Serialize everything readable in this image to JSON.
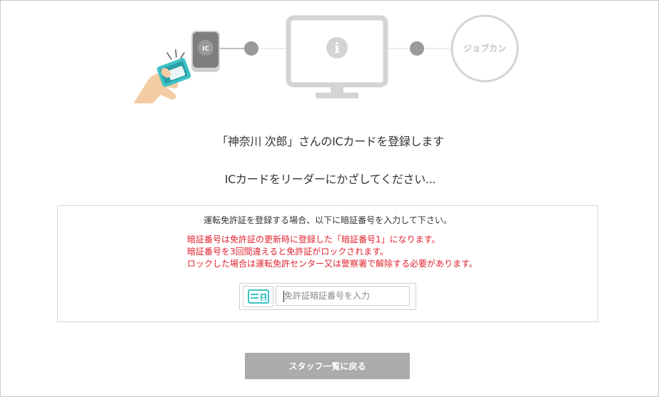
{
  "steps": {
    "reader_label": "IC",
    "card_label": "IC",
    "info_icon": "i",
    "end_label": "ジョブカン"
  },
  "headline": {
    "register": "「神奈川 次郎」さんのICカードを登録します",
    "prompt": "ICカードをリーダーにかざしてください..."
  },
  "pin_section": {
    "instruction": "運転免許証を登録する場合、以下に暗証番号を入力して下さい。",
    "warnings": [
      "暗証番号は免許証の更新時に登録した「暗証番号1」になります。",
      "暗証番号を3回間違えると免許証がロックされます。",
      "ロックした場合は運転免許センター又は警察署で解除する必要があります。"
    ],
    "input_placeholder": "免許証暗証番号を入力",
    "input_value": "",
    "card_icon": "license-card-icon"
  },
  "buttons": {
    "back": "スタッフ一覧に戻る"
  },
  "colors": {
    "warning": "#e0242f",
    "accent": "#3cc3c8",
    "button_bg": "#ababab",
    "step_gray": "#c4c4c4"
  }
}
